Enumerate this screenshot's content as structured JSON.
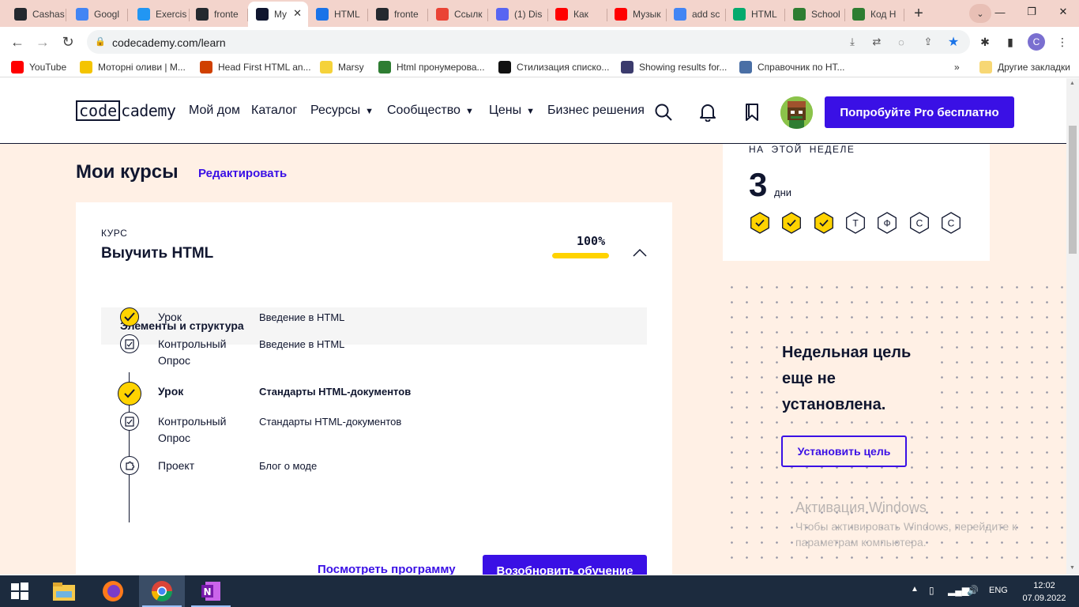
{
  "browser": {
    "tabs": [
      {
        "label": "Cashas",
        "icon": "github-icon",
        "color": "#24292f"
      },
      {
        "label": "Googl",
        "icon": "google-translate-icon",
        "color": "#4285f4"
      },
      {
        "label": "Exercis",
        "icon": "freecodecamp-icon",
        "color": "#2196f3"
      },
      {
        "label": "fronte",
        "icon": "github-icon",
        "color": "#24292f"
      },
      {
        "label": "My",
        "icon": "codecademy-icon",
        "color": "#10162f",
        "active": true
      },
      {
        "label": "HTML",
        "icon": "htmlacademy-icon",
        "color": "#1a73e8"
      },
      {
        "label": "fronte",
        "icon": "github-icon",
        "color": "#24292f"
      },
      {
        "label": "Ссылк",
        "icon": "gmail-icon",
        "color": "#ea4335"
      },
      {
        "label": "(1) Dis",
        "icon": "discord-icon",
        "color": "#5865f2"
      },
      {
        "label": "Как",
        "icon": "youtube-icon",
        "color": "#ff0000"
      },
      {
        "label": "Музык",
        "icon": "youtube-icon",
        "color": "#ff0000"
      },
      {
        "label": "add sc",
        "icon": "google-icon",
        "color": "#4285f4"
      },
      {
        "label": "HTML",
        "icon": "w3-icon",
        "color": "#04aa6d"
      },
      {
        "label": "School",
        "icon": "w3schools-icon",
        "color": "#2e7d32"
      },
      {
        "label": "Код H",
        "icon": "w3schools-icon",
        "color": "#2e7d32"
      }
    ],
    "new_tab": "+",
    "url": "codecademy.com/learn",
    "profile_initial": "C",
    "bookmarks": [
      {
        "label": "YouTube",
        "icon": "youtube-icon",
        "color": "#ff0000"
      },
      {
        "label": "Моторні оливи | М...",
        "icon": "ft-icon",
        "color": "#f4c400"
      },
      {
        "label": "Head First HTML an...",
        "icon": "wg-icon",
        "color": "#d04000"
      },
      {
        "label": "Marsy",
        "icon": "marsy-icon",
        "color": "#f5d23a"
      },
      {
        "label": "Html пронумерова...",
        "icon": "s-icon",
        "color": "#2e7d32"
      },
      {
        "label": "Стилизация списко...",
        "icon": "m-icon",
        "color": "#111111"
      },
      {
        "label": "Showing results for...",
        "icon": "owl-icon",
        "color": "#3b3b6d"
      },
      {
        "label": "Справочник по HT...",
        "icon": "gear-icon",
        "color": "#4a6fa5"
      }
    ],
    "more_bookmarks": "»",
    "other_bookmarks": "Другие закладки"
  },
  "site": {
    "logo_box": "code",
    "logo_rest": "cademy",
    "nav": [
      "Мой дом",
      "Каталог",
      "Ресурсы",
      "Сообщество",
      "Цены",
      "Бизнес решения"
    ],
    "pro_button": "Попробуйте Pro бесплатно",
    "my_courses": "Мои курсы",
    "edit": "Редактировать",
    "course": {
      "kicker": "КУРС",
      "title": "Выучить HTML",
      "progress_label": "100%",
      "progress": 1.0,
      "section": "Элементы и структура",
      "items": [
        {
          "type": "Урок",
          "name": "Введение в HTML",
          "kind": "lesson-done",
          "current": false
        },
        {
          "type": "Контрольный Опрос",
          "name": "Введение в HTML",
          "kind": "quiz",
          "current": false
        },
        {
          "type": "Урок",
          "name": "Стандарты HTML-документов",
          "kind": "lesson-done",
          "current": true
        },
        {
          "type": "Контрольный Опрос",
          "name": "Стандарты HTML-документов",
          "kind": "quiz",
          "current": false
        },
        {
          "type": "Проект",
          "name": "Блог о моде",
          "kind": "project",
          "current": false
        }
      ],
      "view_syllabus": "Посмотреть программу",
      "resume": "Возобновить обучение"
    },
    "streak": {
      "label": "НА ЭТОЙ НЕДЕЛЕ",
      "count": "3",
      "unit": "дни",
      "days": [
        {
          "label": "",
          "done": true
        },
        {
          "label": "",
          "done": true
        },
        {
          "label": "",
          "done": true
        },
        {
          "label": "Т",
          "done": false
        },
        {
          "label": "Ф",
          "done": false
        },
        {
          "label": "С",
          "done": false
        },
        {
          "label": "С",
          "done": false
        }
      ]
    },
    "goal": {
      "text": "Недельная цель еще не установлена.",
      "button": "Установить цель"
    },
    "activation": {
      "title": "Активация Windows",
      "text": "Чтобы активировать Windows, перейдите к параметрам компьютера."
    },
    "colors": {
      "accent": "#3a10e5",
      "yellow": "#ffd300",
      "navy": "#10162f",
      "bg": "#fff0e5"
    }
  },
  "taskbar": {
    "lang": "ENG",
    "time": "12:02",
    "date": "07.09.2022"
  }
}
